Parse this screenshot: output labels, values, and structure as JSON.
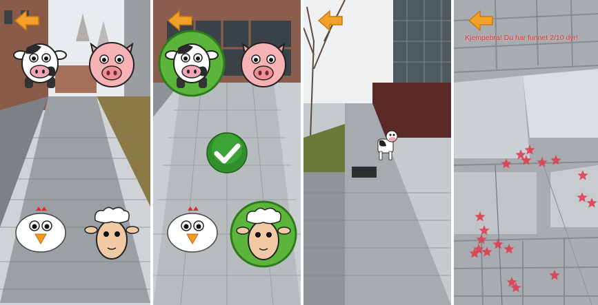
{
  "app": {
    "back_icon": "arrow-left-icon",
    "colors": {
      "back_arrow": "#f3a028",
      "found_ring": "#3ea22a",
      "message": "#e8262c",
      "stars": "#e0384a"
    }
  },
  "panels": [
    {
      "animals": [
        "cow",
        "pig",
        "chicken",
        "sheep"
      ],
      "found": []
    },
    {
      "animals": [
        "cow",
        "pig",
        "chicken",
        "sheep"
      ],
      "found": [
        "cow",
        "sheep"
      ],
      "confirm_icon": "checkmark-icon"
    },
    {
      "animals": [
        "cow"
      ],
      "found": []
    },
    {
      "message": "Kjempebra! Du har funnet 2/10 dyr!",
      "effect_icon": "star-icon"
    }
  ]
}
